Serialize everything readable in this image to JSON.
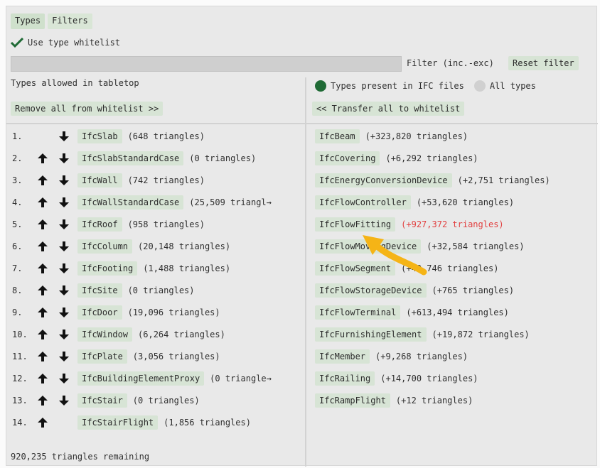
{
  "tabs": [
    "Types",
    "Filters"
  ],
  "whitelist_checkbox": {
    "label": "Use type whitelist",
    "checked": true
  },
  "filter": {
    "value": "",
    "label": "Filter (inc.-exc)",
    "reset_label": "Reset filter"
  },
  "left": {
    "heading": "Types allowed in tabletop",
    "remove_label": "Remove all from whitelist >>",
    "rows": [
      {
        "index": "1.",
        "name": "IfcSlab",
        "triangles": "(648 triangles)",
        "up": false,
        "down": true
      },
      {
        "index": "2.",
        "name": "IfcSlabStandardCase",
        "triangles": "(0 triangles)",
        "up": true,
        "down": true
      },
      {
        "index": "3.",
        "name": "IfcWall",
        "triangles": "(742 triangles)",
        "up": true,
        "down": true
      },
      {
        "index": "4.",
        "name": "IfcWallStandardCase",
        "triangles": "(25,509 triangl→",
        "up": true,
        "down": true
      },
      {
        "index": "5.",
        "name": "IfcRoof",
        "triangles": "(958 triangles)",
        "up": true,
        "down": true
      },
      {
        "index": "6.",
        "name": "IfcColumn",
        "triangles": "(20,148 triangles)",
        "up": true,
        "down": true
      },
      {
        "index": "7.",
        "name": "IfcFooting",
        "triangles": "(1,488 triangles)",
        "up": true,
        "down": true
      },
      {
        "index": "8.",
        "name": "IfcSite",
        "triangles": "(0 triangles)",
        "up": true,
        "down": true
      },
      {
        "index": "9.",
        "name": "IfcDoor",
        "triangles": "(19,096 triangles)",
        "up": true,
        "down": true
      },
      {
        "index": "10.",
        "name": "IfcWindow",
        "triangles": "(6,264 triangles)",
        "up": true,
        "down": true
      },
      {
        "index": "11.",
        "name": "IfcPlate",
        "triangles": "(3,056 triangles)",
        "up": true,
        "down": true
      },
      {
        "index": "12.",
        "name": "IfcBuildingElementProxy",
        "triangles": "(0 triangle→",
        "up": true,
        "down": true
      },
      {
        "index": "13.",
        "name": "IfcStair",
        "triangles": "(0 triangles)",
        "up": true,
        "down": true
      },
      {
        "index": "14.",
        "name": "IfcStairFlight",
        "triangles": "(1,856 triangles)",
        "up": true,
        "down": false
      }
    ]
  },
  "right": {
    "radio_present_label": "Types present in IFC files",
    "radio_all_label": "All types",
    "transfer_label": "<< Transfer all to whitelist",
    "rows": [
      {
        "name": "IfcBeam",
        "triangles": "(+323,820 triangles)",
        "warn": false
      },
      {
        "name": "IfcCovering",
        "triangles": "(+6,292 triangles)",
        "warn": false
      },
      {
        "name": "IfcEnergyConversionDevice",
        "triangles": "(+2,751 triangles)",
        "warn": false
      },
      {
        "name": "IfcFlowController",
        "triangles": "(+53,620 triangles)",
        "warn": false
      },
      {
        "name": "IfcFlowFitting",
        "triangles": "(+927,372 triangles)",
        "warn": true
      },
      {
        "name": "IfcFlowMovingDevice",
        "triangles": "(+32,584 triangles)",
        "warn": false
      },
      {
        "name": "IfcFlowSegment",
        "triangles": "(+49,746 triangles)",
        "warn": false
      },
      {
        "name": "IfcFlowStorageDevice",
        "triangles": "(+765 triangles)",
        "warn": false
      },
      {
        "name": "IfcFlowTerminal",
        "triangles": "(+613,494 triangles)",
        "warn": false
      },
      {
        "name": "IfcFurnishingElement",
        "triangles": "(+19,872 triangles)",
        "warn": false
      },
      {
        "name": "IfcMember",
        "triangles": "(+9,268 triangles)",
        "warn": false
      },
      {
        "name": "IfcRailing",
        "triangles": "(+14,700 triangles)",
        "warn": false
      },
      {
        "name": "IfcRampFlight",
        "triangles": "(+12 triangles)",
        "warn": false
      }
    ]
  },
  "footer": {
    "remaining": "920,235 triangles remaining"
  },
  "colors": {
    "accent_green": "#1f6a35",
    "warning_red": "#e24040",
    "annotation_arrow": "#f5b416",
    "button_bg": "#d7e4d5"
  },
  "icons": {
    "check": "check-icon",
    "up": "arrow-up-icon",
    "down": "arrow-down-icon",
    "annotation": "curved-arrow-annotation"
  }
}
